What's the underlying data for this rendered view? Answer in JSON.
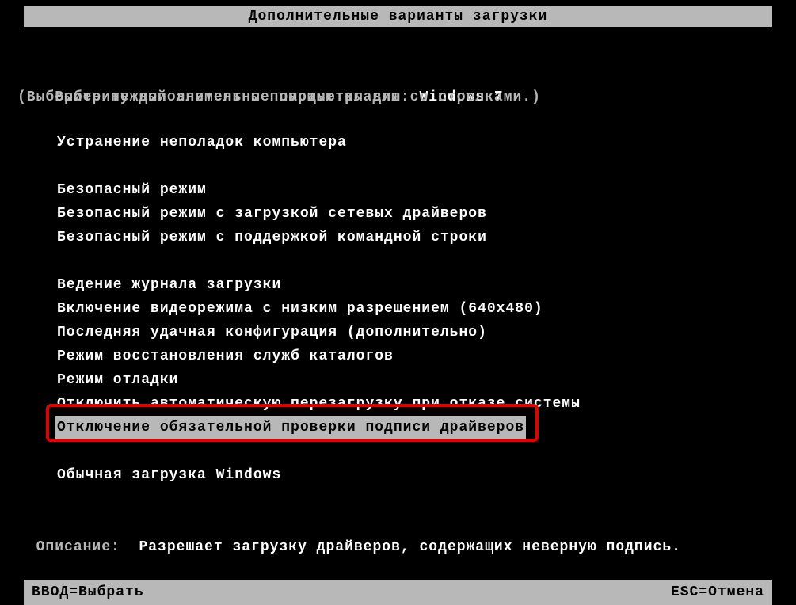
{
  "title": "Дополнительные варианты загрузки",
  "prompt_prefix": "Выберите дополнительные параметры для:",
  "os_name": "Windows 7",
  "instruction": "(Выберите нужный элемент с помощью клавиш со стрелками.)",
  "menu": {
    "group1": [
      "Устранение неполадок компьютера"
    ],
    "group2": [
      "Безопасный режим",
      "Безопасный режим с загрузкой сетевых драйверов",
      "Безопасный режим с поддержкой командной строки"
    ],
    "group3": [
      "Ведение журнала загрузки",
      "Включение видеорежима с низким разрешением (640x480)",
      "Последняя удачная конфигурация (дополнительно)",
      "Режим восстановления служб каталогов",
      "Режим отладки",
      "Отключить автоматическую перезагрузку при отказе системы",
      "Отключение обязательной проверки подписи драйверов"
    ],
    "group4": [
      "Обычная загрузка Windows"
    ],
    "selected": "Отключение обязательной проверки подписи драйверов"
  },
  "description_label": "Описание:",
  "description_text": "Разрешает загрузку драйверов, содержащих неверную подпись.",
  "footer": {
    "enter": "ВВОД=Выбрать",
    "esc": "ESC=Отмена"
  }
}
